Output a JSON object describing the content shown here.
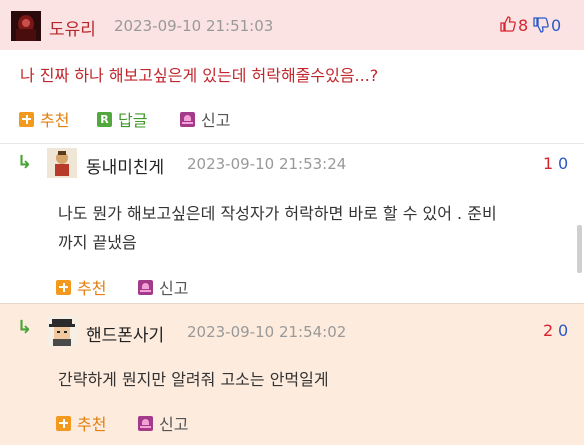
{
  "colors": {
    "header_bg": "#fbe3e4",
    "reply_bg": "#fdebdd",
    "up": "#d7242d",
    "down": "#2a59c7",
    "accent_red": "#c0272d"
  },
  "main_comment": {
    "nickname": "도유리",
    "timestamp": "2023-09-10 21:51:03",
    "up_count": "8",
    "down_count": "0",
    "text": "나 진짜 하나 해보고싶은게 있는데 허락해줄수있음...?",
    "actions": {
      "recommend": "추천",
      "reply": "답글",
      "report": "신고"
    },
    "icons": {
      "thumbs_up": "thumbs-up-icon",
      "thumbs_down": "thumbs-down-icon"
    }
  },
  "replies": [
    {
      "nickname": "동내미친게",
      "timestamp": "2023-09-10 21:53:24",
      "up_count": "1",
      "down_count": "0",
      "text_line1": "나도 뭔가 해보고싶은데 작성자가 허락하면 바로 할 수 있어 . 준비",
      "text_line2": "까지 끝냈음",
      "actions": {
        "recommend": "추천",
        "report": "신고"
      }
    },
    {
      "nickname": "핸드폰사기",
      "timestamp": "2023-09-10 21:54:02",
      "up_count": "2",
      "down_count": "0",
      "text_line1": "간략하게 뭔지만 알려줘 고소는 안먹일게",
      "actions": {
        "recommend": "추천",
        "report": "신고"
      }
    }
  ],
  "reply_arrow": "↳"
}
